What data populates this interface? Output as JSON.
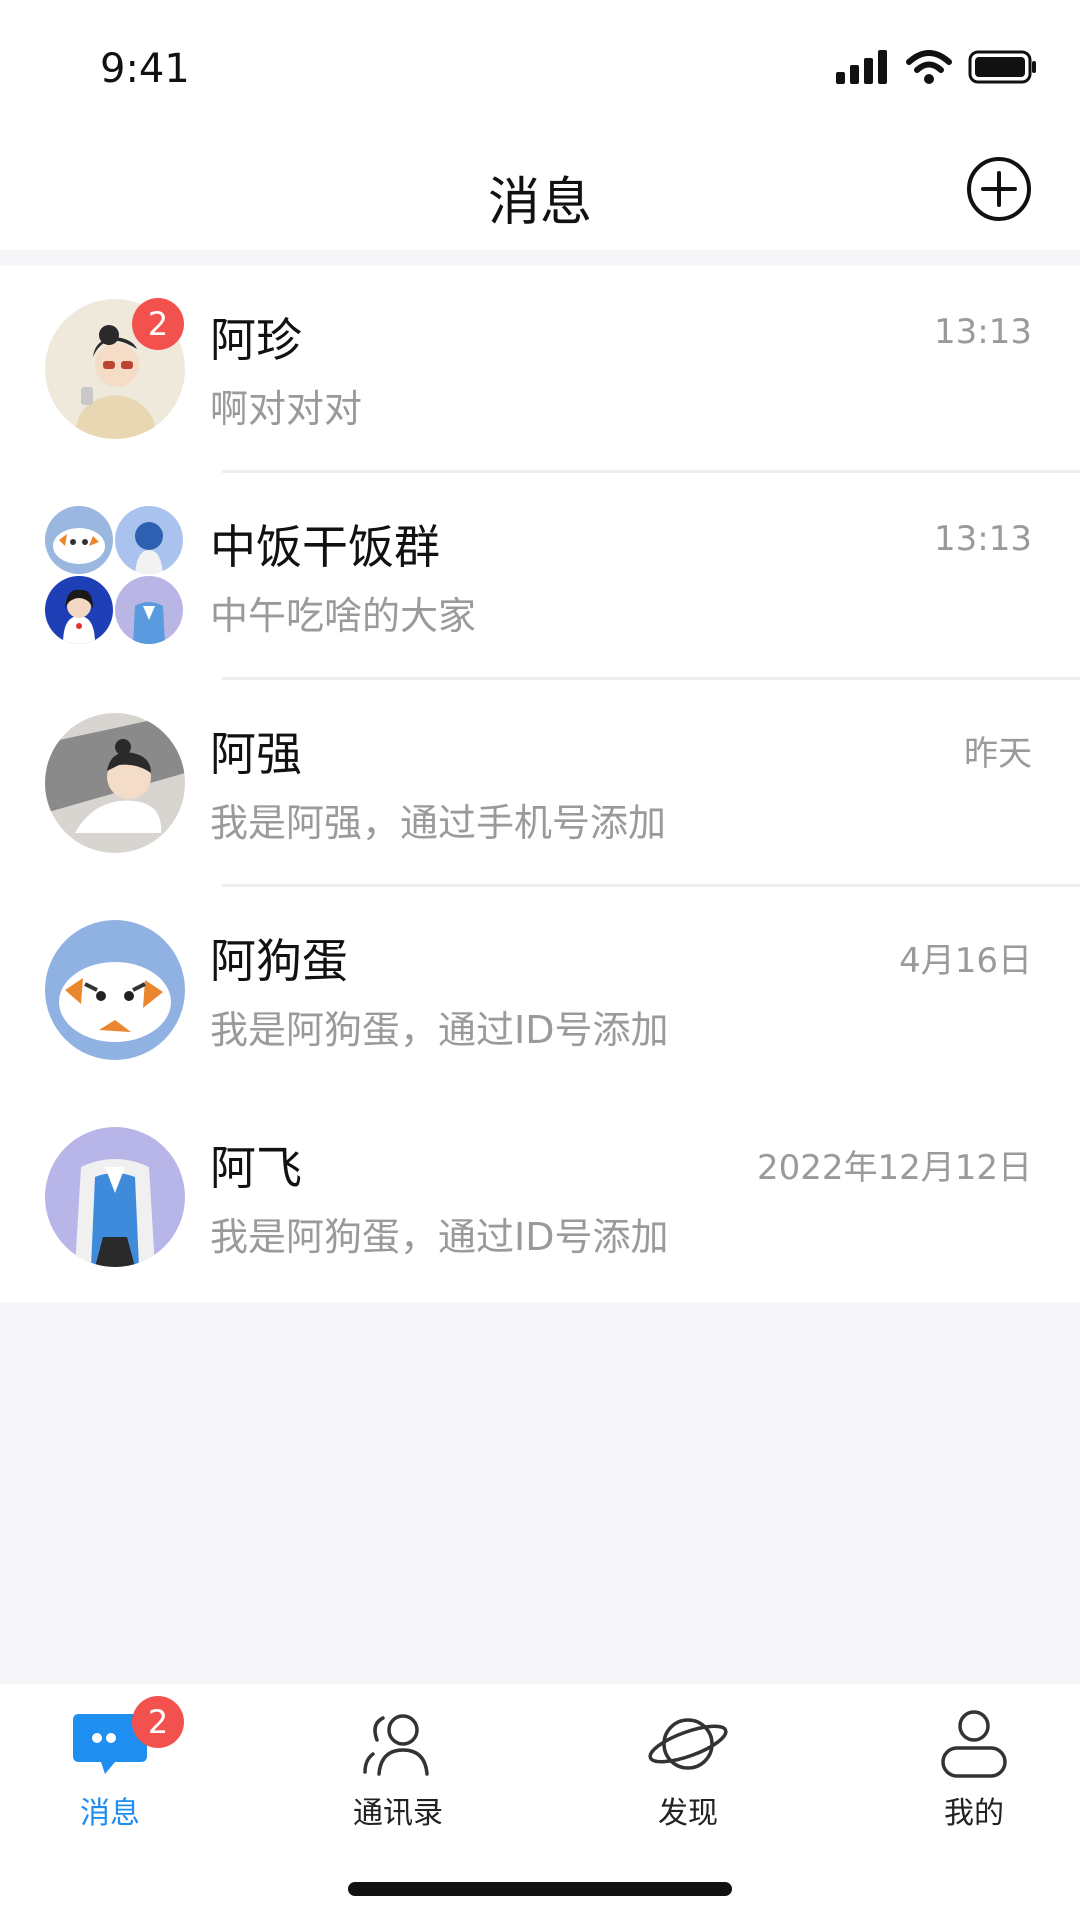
{
  "status_bar": {
    "time": "9:41"
  },
  "header": {
    "title": "消息"
  },
  "conversations": [
    {
      "name": "阿珍",
      "preview": "啊对对对",
      "time": "13:13",
      "unread": "2"
    },
    {
      "name": "中饭干饭群",
      "preview": "中午吃啥的大家",
      "time": "13:13"
    },
    {
      "name": "阿强",
      "preview": "我是阿强，通过手机号添加",
      "time": "昨天"
    },
    {
      "name": "阿狗蛋",
      "preview": "我是阿狗蛋，通过ID号添加",
      "time": "4月16日"
    },
    {
      "name": "阿飞",
      "preview": "我是阿狗蛋，通过ID号添加",
      "time": "2022年12月12日"
    }
  ],
  "tabs": [
    {
      "label": "消息",
      "icon": "chat-bubble-icon",
      "badge": "2",
      "active": true
    },
    {
      "label": "通讯录",
      "icon": "contacts-icon"
    },
    {
      "label": "发现",
      "icon": "planet-icon"
    },
    {
      "label": "我的",
      "icon": "profile-icon"
    }
  ],
  "colors": {
    "accent": "#1f8ef1",
    "badge": "#f2514d",
    "secondary_text": "#9a9a9a"
  }
}
